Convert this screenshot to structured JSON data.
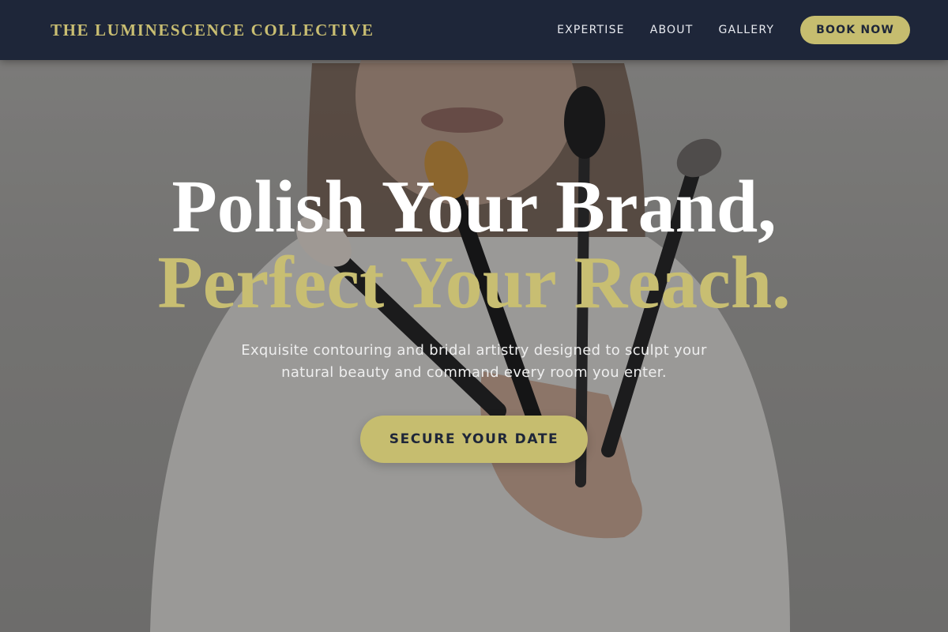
{
  "nav": {
    "brand": "THE LUMINESCENCE COLLECTIVE",
    "links": [
      {
        "label": "EXPERTISE"
      },
      {
        "label": "ABOUT"
      },
      {
        "label": "GALLERY"
      }
    ],
    "book_label": "BOOK NOW"
  },
  "hero": {
    "headline_line1": "Polish Your Brand,",
    "headline_line2": "Perfect Your Reach.",
    "subtext": "Exquisite contouring and bridal artistry designed to sculpt your natural beauty and command every room you enter.",
    "cta_label": "SECURE YOUR DATE",
    "background_image": "woman-holding-makeup-brushes"
  },
  "colors": {
    "nav_bg": "#1e2639",
    "accent_gold": "#c6bd6f",
    "headline_white": "#ffffff"
  }
}
